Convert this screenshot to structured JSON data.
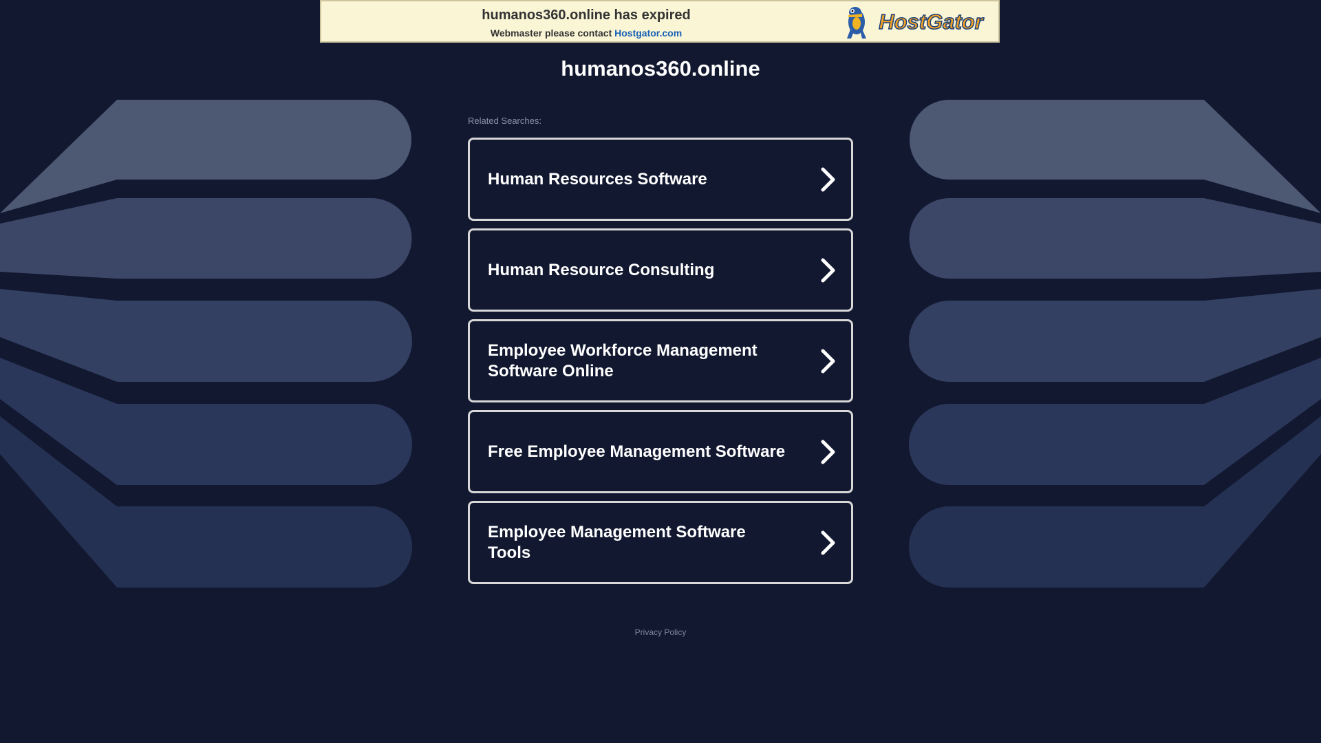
{
  "banner": {
    "title": "humanos360.online has expired",
    "sub_prefix": "Webmaster please contact",
    "sub_link": "Hostgator.com",
    "logo_text": "HostGator"
  },
  "domain_title": "humanos360.online",
  "related_label": "Related Searches:",
  "results": [
    {
      "label": "Human Resources Software"
    },
    {
      "label": "Human Resource Consulting"
    },
    {
      "label": "Employee Workforce Management Software Online"
    },
    {
      "label": "Free Employee Management Software"
    },
    {
      "label": "Employee Management Software Tools"
    }
  ],
  "footer": {
    "privacy": "Privacy Policy"
  },
  "colors": {
    "background": "#121830",
    "card_border": "#d8d8d8",
    "banner_bg": "#f9f5d5",
    "link": "#1760b5"
  }
}
